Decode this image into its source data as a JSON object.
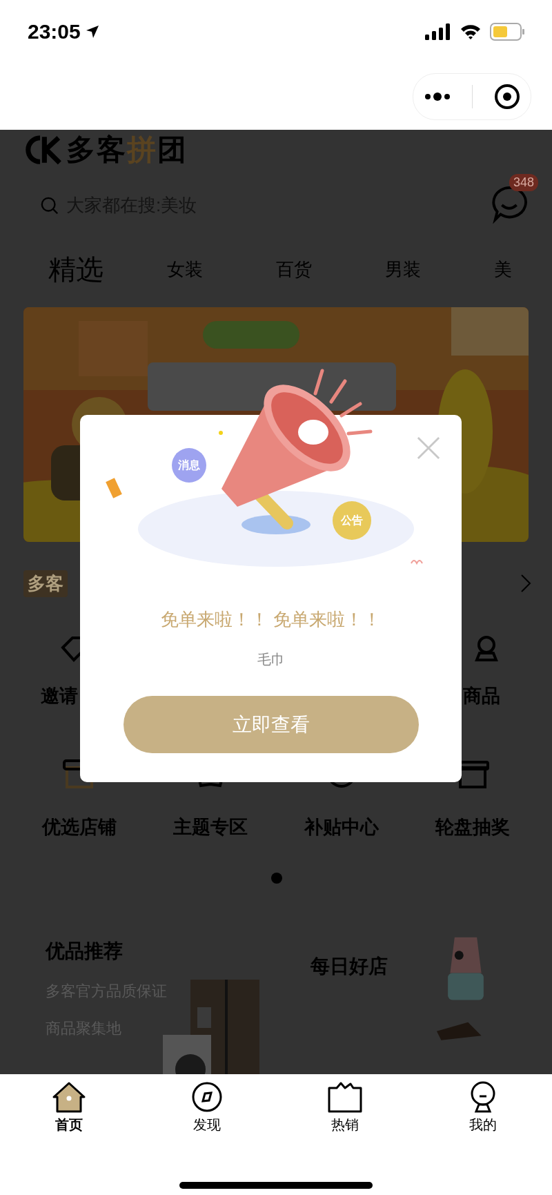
{
  "status_bar": {
    "time": "23:05"
  },
  "header": {
    "logo": {
      "parts": [
        {
          "text": "多客",
          "accent": false
        },
        {
          "text": "拼",
          "accent": true
        },
        {
          "text": "团",
          "accent": false
        }
      ]
    },
    "search": {
      "placeholder": "大家都在搜:美妆"
    },
    "messages": {
      "badge": "348"
    }
  },
  "tabs": [
    {
      "label": "精选",
      "selected": true
    },
    {
      "label": "女装",
      "selected": false
    },
    {
      "label": "百货",
      "selected": false
    },
    {
      "label": "男装",
      "selected": false
    },
    {
      "label": "美",
      "selected": false
    }
  ],
  "banner": {
    "kind": "picture"
  },
  "section": {
    "tag": "多客"
  },
  "shortcuts": [
    [
      {
        "label": "邀请"
      },
      {
        "label": "商品"
      }
    ],
    [
      {
        "label": "优选店铺"
      },
      {
        "label": "主题专区"
      },
      {
        "label": "补贴中心"
      },
      {
        "label": "轮盘抽奖"
      }
    ]
  ],
  "cards": [
    {
      "title": "优品推荐",
      "lines": [
        "多客官方品质保证",
        "商品聚集地"
      ]
    },
    {
      "title": "每日好店"
    }
  ],
  "popup": {
    "bubbles": [
      {
        "text": "消息",
        "color": "#9ea3f0"
      },
      {
        "text": "公告",
        "color": "#e8c95a"
      }
    ],
    "title": "免单来啦！！ 免单来啦！！",
    "subtitle": "毛巾",
    "button": "立即查看"
  },
  "tab_bar": [
    {
      "label": "首页",
      "selected": true
    },
    {
      "label": "发现",
      "selected": false
    },
    {
      "label": "热销",
      "selected": false
    },
    {
      "label": "我的",
      "selected": false
    }
  ]
}
